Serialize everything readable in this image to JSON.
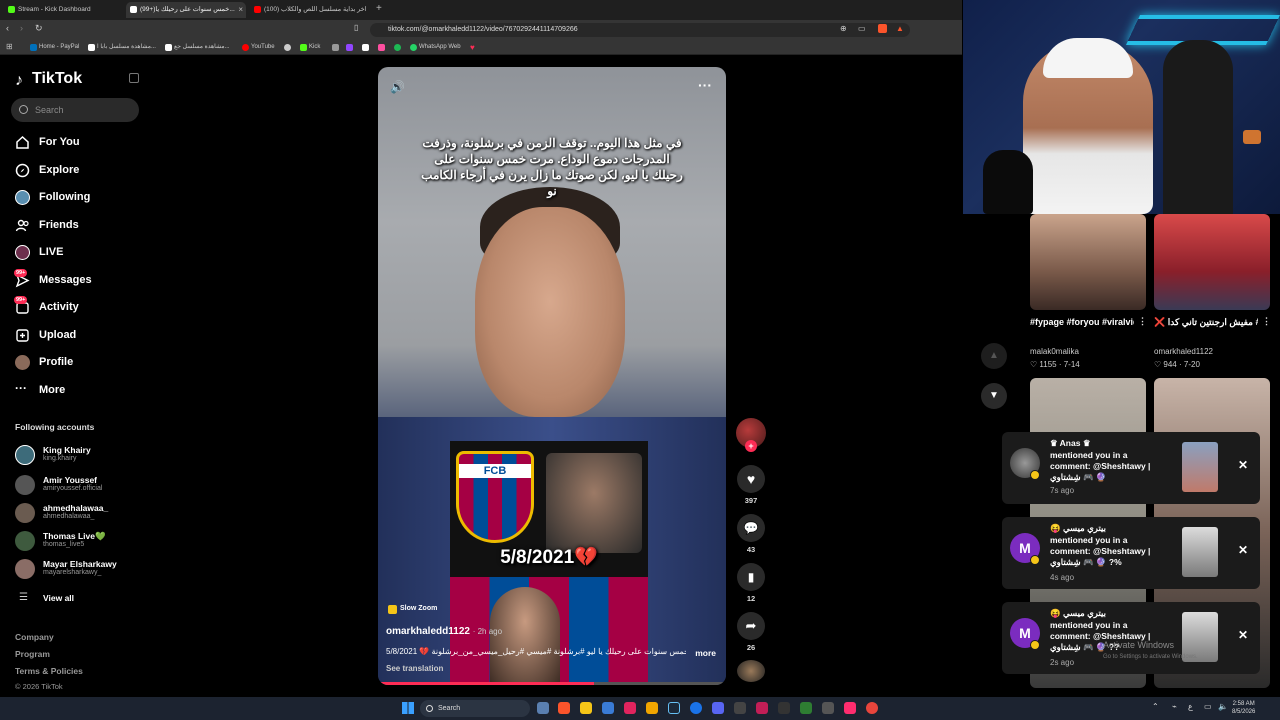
{
  "browser": {
    "tabs": [
      {
        "label": "Stream - Kick Dashboard",
        "color": "#53fc18"
      },
      {
        "label": "(99+)خمس سنوات على رحيلك يا...",
        "color": "#ffffff"
      },
      {
        "label": "(100) اخر بداية مسلسل اللص والكلاب",
        "color": "#ff0000"
      }
    ],
    "url": "tiktok.com/@omarkhaledd1122/video/7670292441114709266",
    "bookmarks": [
      {
        "label": "Home - PayPal",
        "color": "#0070ba"
      },
      {
        "label": "مشاهدة مسلسل بابا ا...",
        "color": "#ffffff"
      },
      {
        "label": "مشاهدة مسلسل جع...",
        "color": "#ffffff"
      },
      {
        "label": "YouTube",
        "color": "#ff0000"
      },
      {
        "label": "Kick",
        "color": "#53fc18"
      },
      {
        "label": "WhatsApp Web",
        "color": "#25d366"
      }
    ]
  },
  "sidebar": {
    "logo": "TikTok",
    "search_placeholder": "Search",
    "nav": [
      {
        "label": "For You",
        "icon": "home-icon"
      },
      {
        "label": "Explore",
        "icon": "compass-icon"
      },
      {
        "label": "Following",
        "icon": "following-avatar-icon"
      },
      {
        "label": "Friends",
        "icon": "friends-icon"
      },
      {
        "label": "LIVE",
        "icon": "live-icon"
      },
      {
        "label": "Messages",
        "icon": "messages-icon",
        "badge": "99+"
      },
      {
        "label": "Activity",
        "icon": "activity-icon",
        "badge": "99+"
      },
      {
        "label": "Upload",
        "icon": "upload-icon"
      },
      {
        "label": "Profile",
        "icon": "profile-avatar-icon"
      },
      {
        "label": "More",
        "icon": "more-icon"
      }
    ],
    "following_title": "Following accounts",
    "accounts": [
      {
        "name": "King Khairy",
        "handle": "king.khairy"
      },
      {
        "name": "Amir Youssef",
        "handle": "amiryoussef.official"
      },
      {
        "name": "ahmedhalawaa_",
        "handle": "ahmedhalawaa_"
      },
      {
        "name": "Thomas Live💚",
        "handle": "thomas_live5"
      },
      {
        "name": "Mayar Elsharkawy",
        "handle": "mayarelsharkawy_"
      }
    ],
    "view_all": "View all",
    "footer": [
      "Company",
      "Program",
      "Terms & Policies",
      "© 2026 TikTok"
    ]
  },
  "video": {
    "overlay_text": "في مثل هذا اليوم.. توقف الزمن في برشلونة، وذرفت المدرجات دموع الوداع. مرت خمس سنوات على رحيلك يا ليو، لكن صوتك ما زال يرن في أرجاء الكامب نو",
    "inset_date": "5/8/2021💔",
    "crest_text": "FCB",
    "effect": "Slow Zoom",
    "author": "omarkhaledd1122",
    "posted": "· 2h ago",
    "caption": "5/8/2021 💔 خمس سنوات على رحيلك يا ليو #برشلونة #ميسي #رحيل_ميسي_من_برشلونة",
    "more": "more",
    "translate": "See translation",
    "progress": 0.62
  },
  "actions": {
    "likes": "397",
    "comments": "43",
    "saves": "12",
    "shares": "26"
  },
  "recommended": [
    {
      "title": "#fypage #foryou #viralvideo #viral...",
      "user": "malak0malika",
      "likes": "1155",
      "date": "7-14"
    },
    {
      "title": "❌ مفيش ارجنتين تاني كدا #fifaworldcup...",
      "user": "omarkhaled1122",
      "likes": "944",
      "date": "7-20"
    }
  ],
  "notifications": [
    {
      "title": "♛ Anas ♛",
      "message": "mentioned you in a comment: @Sheshtawy | شِشتاوي 🎮 🔮",
      "ago": "7s ago",
      "avatar_color": "#666666",
      "initial": ""
    },
    {
      "title": "😝 بيتري ميسي",
      "message": "mentioned you in a comment: @Sheshtawy | شِشتاوي 🎮 🔮 ?%",
      "ago": "4s ago",
      "avatar_color": "#7b2cbf",
      "initial": "M"
    },
    {
      "title": "😝 بيتري ميسي",
      "message": "mentioned you in a comment: @Sheshtawy | شِشتاوي 🎮 🔮 ??",
      "ago": "2s ago",
      "avatar_color": "#7b2cbf",
      "initial": "M"
    }
  ],
  "windows_watermark": {
    "line1": "Activate Windows",
    "line2": "Go to Settings to activate Windows."
  },
  "taskbar": {
    "search": "Search",
    "time": "2:58 AM",
    "date": "8/5/2026"
  }
}
